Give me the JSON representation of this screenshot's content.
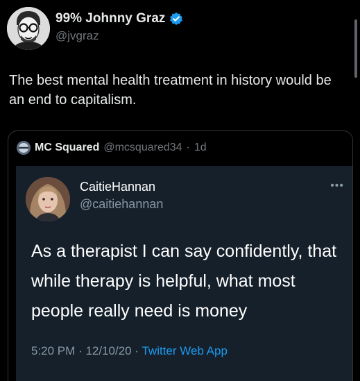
{
  "author": {
    "display_name": "99% Johnny Graz",
    "handle": "@jvgraz",
    "avatar_icon": "avatar-icon",
    "verified_icon": "verified-badge-icon"
  },
  "tweet": {
    "text": "The best mental health treatment in history would be an end to capitalism."
  },
  "quote": {
    "display_name": "MC Squared",
    "handle": "@mcsquared34",
    "separator": "·",
    "time_ago": "1d",
    "embedded": {
      "display_name": "CaitieHannan",
      "handle": "@caitiehannan",
      "more_icon": "more-icon",
      "more_label": "•••",
      "text": "As a therapist I can say confidently, that while therapy is helpful, what most people really need is money",
      "time": "5:20 PM",
      "separator": "·",
      "date": "12/10/20",
      "source": "Twitter Web App"
    }
  },
  "colors": {
    "background": "#000000",
    "text": "#e7e9ea",
    "secondary": "#71767b",
    "accent": "#1d9bf0",
    "embedded_background": "#15202b"
  }
}
